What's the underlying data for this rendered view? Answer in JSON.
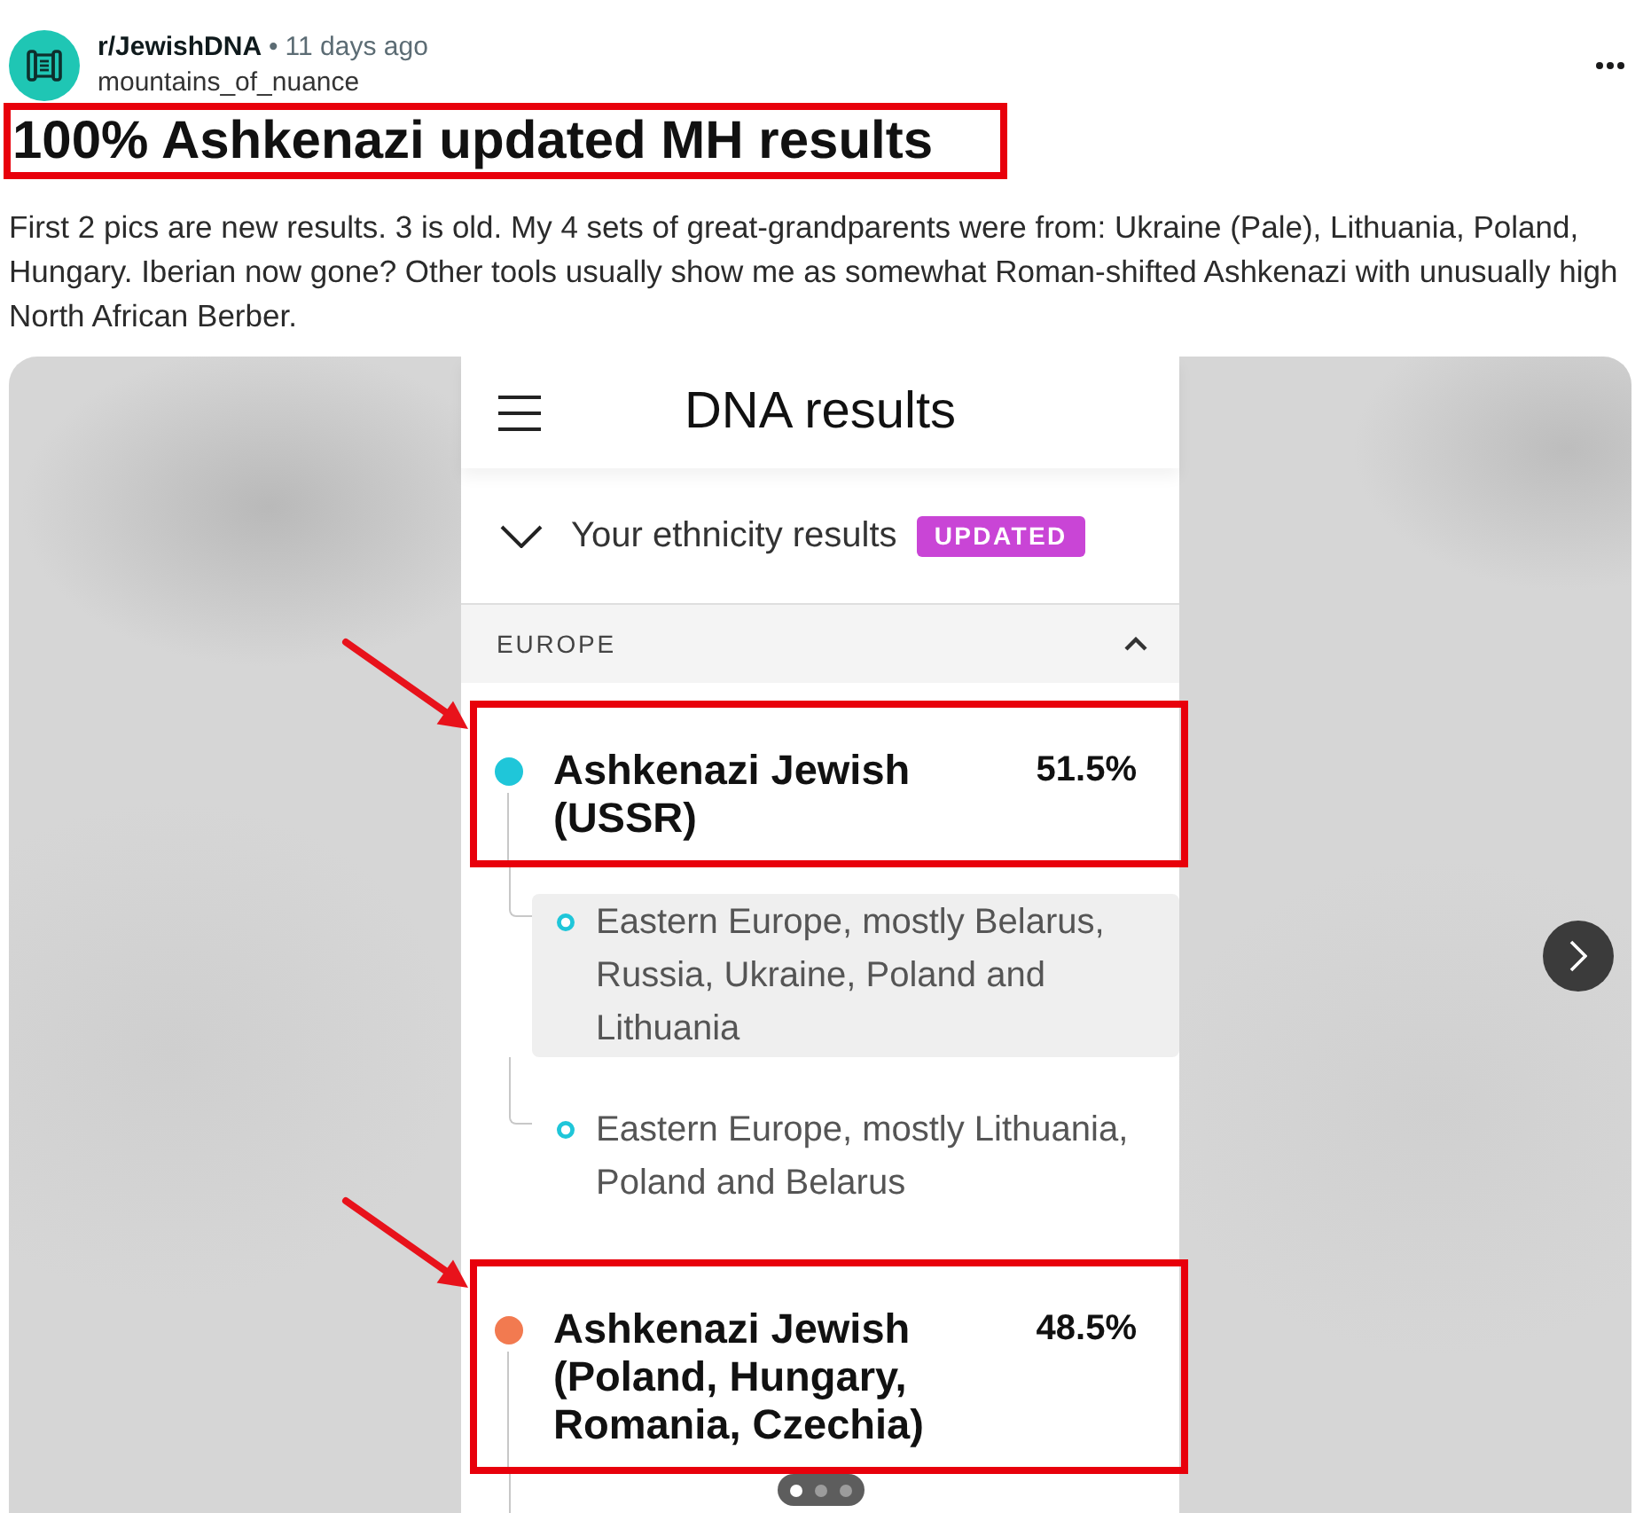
{
  "post": {
    "subreddit": "r/JewishDNA",
    "separator": "•",
    "time": "11 days ago",
    "author": "mountains_of_nuance"
  },
  "title": {
    "text": "100% Ashkenazi updated MH results",
    "highlighted": true
  },
  "body": "First 2 pics are new results. 3 is old. My 4 sets of great-grandparents were from: Ukraine (Pale), Lithuania, Poland, Hungary. Iberian now gone? Other tools usually show me as somewhat Roman-shifted Ashkenazi with unusually high North African Berber.",
  "gallery": {
    "pages": [
      {
        "selected": true
      },
      {
        "selected": false
      },
      {
        "selected": false
      }
    ],
    "screenshot": {
      "header_title": "DNA results",
      "results_label": "Your ethnicity results",
      "badge": "UPDATED",
      "section": {
        "label": "EUROPE",
        "expanded": true
      },
      "ethnicities": [
        {
          "name": "Ashkenazi Jewish (USSR)",
          "percent": "51.5%",
          "color": "#1fc6d9",
          "highlighted": true,
          "children": [
            {
              "name": "Eastern Europe, mostly Belarus, Russia, Ukraine, Poland and Lithuania",
              "selected": true
            },
            {
              "name": "Eastern Europe, mostly Lithuania, Poland and Belarus",
              "selected": false
            }
          ]
        },
        {
          "name": "Ashkenazi Jewish (Poland, Hungary, Romania, Czechia)",
          "percent": "48.5%",
          "color": "#f27a50",
          "highlighted": true
        }
      ]
    }
  }
}
